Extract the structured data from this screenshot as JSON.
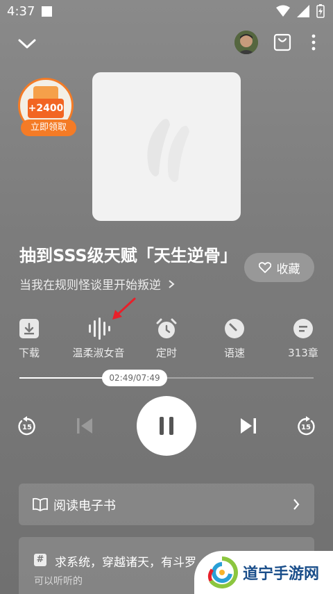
{
  "status": {
    "time": "4:37"
  },
  "coin_badge": {
    "amount": "+2400",
    "claim_label": "立即领取"
  },
  "book": {
    "title": "抽到SSS级天赋「天生逆骨」",
    "subtitle": "当我在规则怪谈里开始叛逆",
    "favorite_label": "收藏"
  },
  "tools": [
    {
      "label": "下载",
      "icon": "download-icon"
    },
    {
      "label": "温柔淑女音",
      "icon": "voice-wave-icon"
    },
    {
      "label": "定时",
      "icon": "alarm-clock-icon"
    },
    {
      "label": "语速",
      "icon": "speed-gauge-icon"
    },
    {
      "label": "313章",
      "icon": "chapter-list-icon"
    }
  ],
  "player": {
    "time_display": "02:49/07:49",
    "progress": 0.36,
    "rewind_seconds": "15",
    "forward_seconds": "15"
  },
  "read_ebook": {
    "label": "阅读电子书"
  },
  "recommendation": {
    "hash": "#",
    "question": "求系统，穿越诸天，有斗罗",
    "sub": "可以听听的"
  },
  "watermark": {
    "text": "道宁手游网"
  },
  "colors": {
    "accent_orange": "#f47b26",
    "arrow_red": "#e8202a",
    "watermark_blue": "#1a4e8a"
  }
}
